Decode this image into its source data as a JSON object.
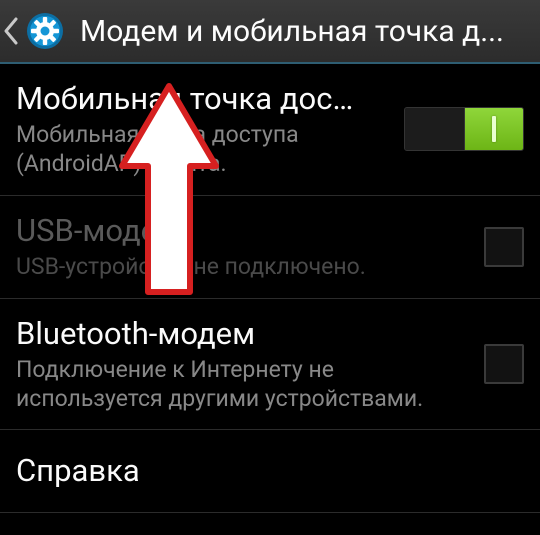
{
  "header": {
    "title": "Модем и мобильная точка д..."
  },
  "rows": {
    "hotspot": {
      "title": "Мобильная точка дос…",
      "subtitle": "Мобильная точка доступа (AndroidAP) занята.",
      "toggle_on": true
    },
    "usb": {
      "title": "USB-модем",
      "subtitle": "USB-устройство не подключено.",
      "enabled": false,
      "checked": false
    },
    "bt": {
      "title": "Bluetooth-модем",
      "subtitle": "Подключение к Интернету не используется другими устройствами.",
      "enabled": true,
      "checked": false
    },
    "help": {
      "title": "Справка"
    }
  },
  "icons": {
    "back": "chevron-left",
    "settings": "gear"
  },
  "colors": {
    "accent": "#2e9ad6",
    "toggle_on": "#7cc521"
  }
}
